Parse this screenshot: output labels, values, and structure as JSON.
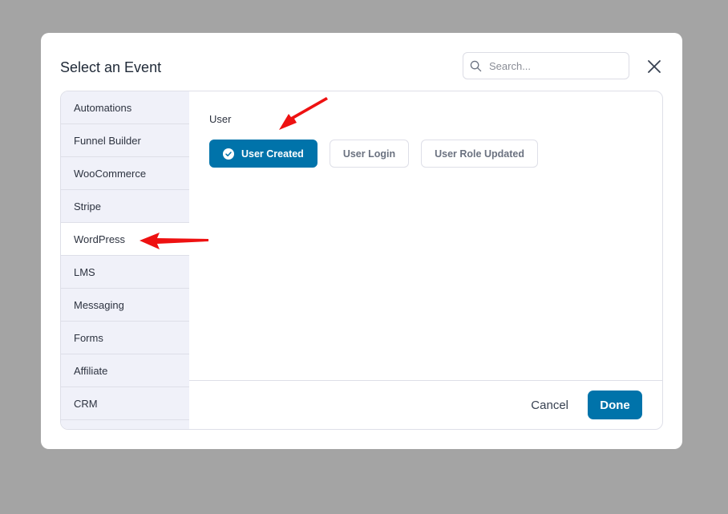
{
  "modal": {
    "title": "Select an Event",
    "search": {
      "placeholder": "Search...",
      "value": ""
    },
    "close_icon": "close-icon"
  },
  "sidebar": {
    "items": [
      {
        "label": "Automations",
        "active": false
      },
      {
        "label": "Funnel Builder",
        "active": false
      },
      {
        "label": "WooCommerce",
        "active": false
      },
      {
        "label": "Stripe",
        "active": false
      },
      {
        "label": "WordPress",
        "active": true
      },
      {
        "label": "LMS",
        "active": false
      },
      {
        "label": "Messaging",
        "active": false
      },
      {
        "label": "Forms",
        "active": false
      },
      {
        "label": "Affiliate",
        "active": false
      },
      {
        "label": "CRM",
        "active": false
      }
    ]
  },
  "content": {
    "group_label": "User",
    "events": [
      {
        "label": "User Created",
        "selected": true
      },
      {
        "label": "User Login",
        "selected": false
      },
      {
        "label": "User Role Updated",
        "selected": false
      }
    ]
  },
  "footer": {
    "cancel_label": "Cancel",
    "done_label": "Done"
  },
  "colors": {
    "primary": "#0073aa",
    "sidebar_bg": "#f0f1f9",
    "overlay": "#a4a4a4",
    "annotation_arrow": "#ee1111"
  }
}
